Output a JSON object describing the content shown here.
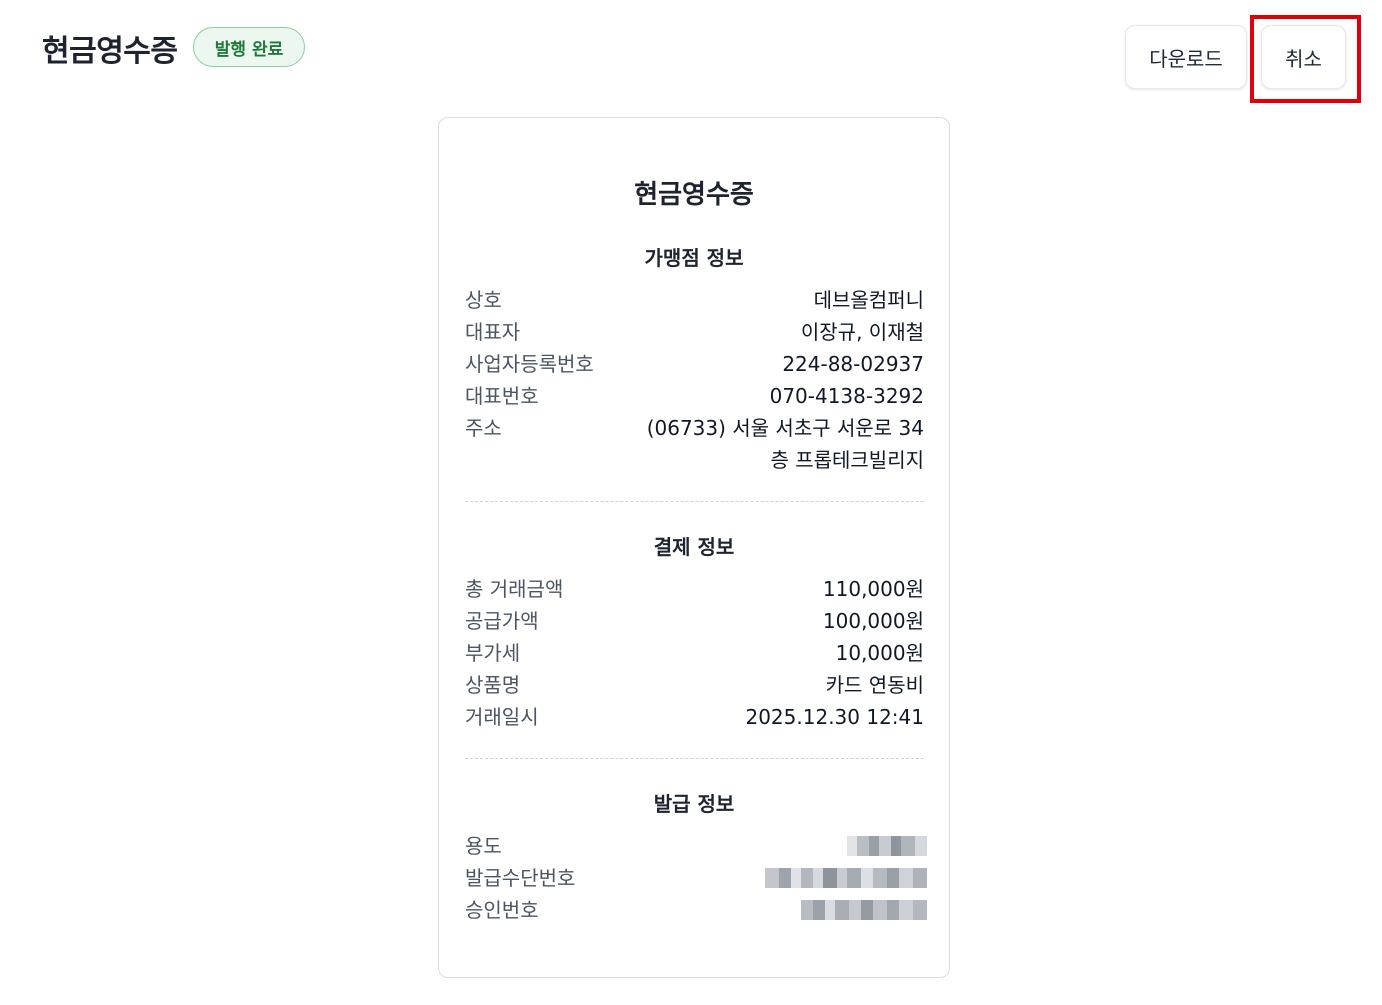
{
  "header": {
    "title": "현금영수증",
    "status_badge": "발행 완료",
    "download_label": "다운로드",
    "cancel_label": "취소"
  },
  "receipt": {
    "title": "현금영수증",
    "merchant": {
      "section_title": "가맹점 정보",
      "rows": [
        {
          "label": "상호",
          "value": "데브올컴퍼니"
        },
        {
          "label": "대표자",
          "value": "이장규, 이재철"
        },
        {
          "label": "사업자등록번호",
          "value": "224-88-02937"
        },
        {
          "label": "대표번호",
          "value": "070-4138-3292"
        },
        {
          "label": "주소",
          "value": "(06733) 서울 서초구 서운로 34층 프롭테크빌리지"
        }
      ]
    },
    "payment": {
      "section_title": "결제 정보",
      "rows": [
        {
          "label": "총 거래금액",
          "value": "110,000원"
        },
        {
          "label": "공급가액",
          "value": "100,000원"
        },
        {
          "label": "부가세",
          "value": "10,000원"
        },
        {
          "label": "상품명",
          "value": "카드 연동비"
        },
        {
          "label": "거래일시",
          "value": "2025.12.30 12:41"
        }
      ]
    },
    "issuance": {
      "section_title": "발급 정보",
      "rows": [
        {
          "label": "용도"
        },
        {
          "label": "발급수단번호"
        },
        {
          "label": "승인번호"
        }
      ]
    }
  },
  "colors": {
    "badge_border": "#86d39f",
    "badge_bg": "#ecf8ef",
    "badge_text": "#1f7a3a",
    "highlight": "#e0000a"
  }
}
